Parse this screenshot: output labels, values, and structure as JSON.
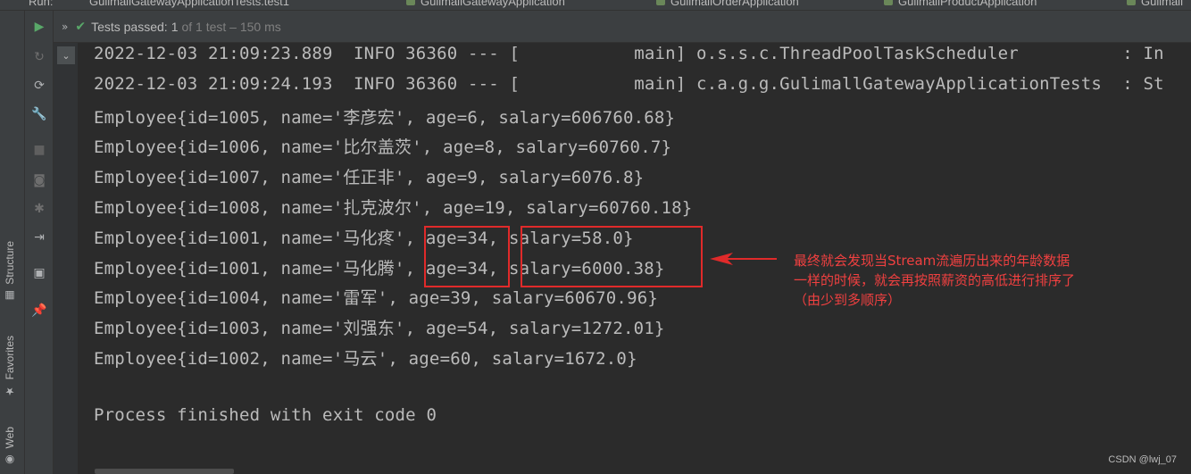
{
  "tabs": [
    {
      "label": "Run:"
    },
    {
      "label": "GulimallGatewayApplicationTests.test1"
    },
    {
      "label": "GulimallGatewayApplication"
    },
    {
      "label": "GulimallOrderApplication"
    },
    {
      "label": "GulimallProductApplication"
    },
    {
      "label": "Gulimall"
    }
  ],
  "side_tools": {
    "structure": "Structure",
    "favorites": "Favorites",
    "web": "Web"
  },
  "status": {
    "label": "Tests passed:",
    "count": "1",
    "rest": "of 1 test – 150 ms"
  },
  "console": {
    "lines": [
      "2022-12-03 21:09:23.889  INFO 36360 --- [           main] o.s.s.c.ThreadPoolTaskScheduler          : In",
      "2022-12-03 21:09:24.193  INFO 36360 --- [           main] c.a.g.g.GulimallGatewayApplicationTests  : St",
      "Employee{id=1005, name='李彦宏', age=6, salary=606760.68}",
      "Employee{id=1006, name='比尔盖茨', age=8, salary=60760.7}",
      "Employee{id=1007, name='任正非', age=9, salary=6076.8}",
      "Employee{id=1008, name='扎克波尔', age=19, salary=60760.18}",
      "Employee{id=1001, name='马化疼', age=34, salary=58.0}",
      "Employee{id=1001, name='马化腾', age=34, salary=6000.38}",
      "Employee{id=1004, name='雷军', age=39, salary=60670.96}",
      "Employee{id=1003, name='刘强东', age=54, salary=1272.01}",
      "Employee{id=1002, name='马云', age=60, salary=1672.0}",
      "",
      "Process finished with exit code 0"
    ]
  },
  "annotation": {
    "line1": "最终就会发现当Stream流遍历出来的年龄数据",
    "line2": "一样的时候，就会再按照薪资的高低进行排序了",
    "line3": "（由少到多顺序）",
    "color": "#f04040"
  },
  "watermark": "CSDN @lwj_07",
  "colors": {
    "background": "#2b2b2b",
    "toolbar": "#3c3f41",
    "pass_green": "#59a869",
    "annotation_red": "#e02a2a"
  }
}
